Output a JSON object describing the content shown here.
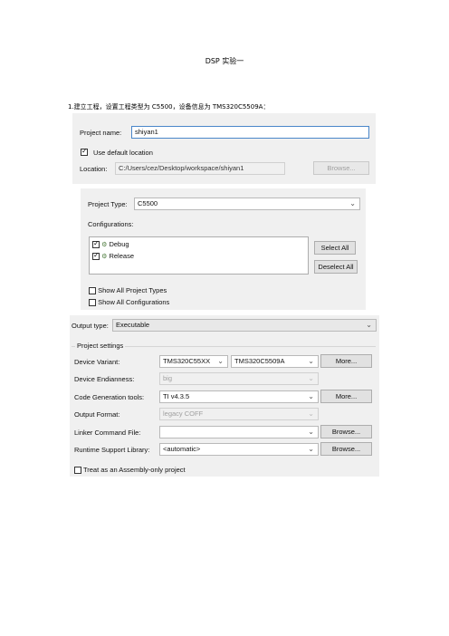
{
  "doc": {
    "title": "DSP 实验一",
    "step1": "1.建立工程，设置工程类型为 C5500，设备信息为 TMS320C5509A："
  },
  "shot1": {
    "project_name_label": "Project name:",
    "project_name_value": "shiyan1",
    "use_default_location_label": "Use default location",
    "use_default_location_checked": true,
    "location_label": "Location:",
    "location_value": "C:/Users/cez/Desktop/workspace/shiyan1",
    "browse_label": "Browse..."
  },
  "shot2": {
    "project_type_label": "Project Type:",
    "project_type_value": "C5500",
    "configurations_label": "Configurations:",
    "configurations": [
      {
        "label": "Debug",
        "checked": true,
        "icon": "config-icon"
      },
      {
        "label": "Release",
        "checked": true,
        "icon": "config-icon"
      }
    ],
    "select_all": "Select All",
    "deselect_all": "Deselect All",
    "show_all_project_types": "Show All Project Types",
    "show_all_configurations": "Show All Configurations"
  },
  "shot3": {
    "output_type_label": "Output type:",
    "output_type_value": "Executable",
    "project_settings": "Project settings",
    "device_variant_label": "Device Variant:",
    "device_family": "TMS320C55XX",
    "device_variant": "TMS320C5509A",
    "more": "More...",
    "device_endianness_label": "Device Endianness:",
    "device_endianness_value": "big",
    "code_gen_label": "Code Generation tools:",
    "code_gen_value": "TI v4.3.5",
    "output_format_label": "Output Format:",
    "output_format_value": "legacy COFF",
    "linker_cmd_label": "Linker Command File:",
    "linker_cmd_value": "",
    "browse": "Browse...",
    "rts_label": "Runtime Support Library:",
    "rts_value": "<automatic>",
    "assembly_only_label": "Treat as an Assembly-only project"
  }
}
